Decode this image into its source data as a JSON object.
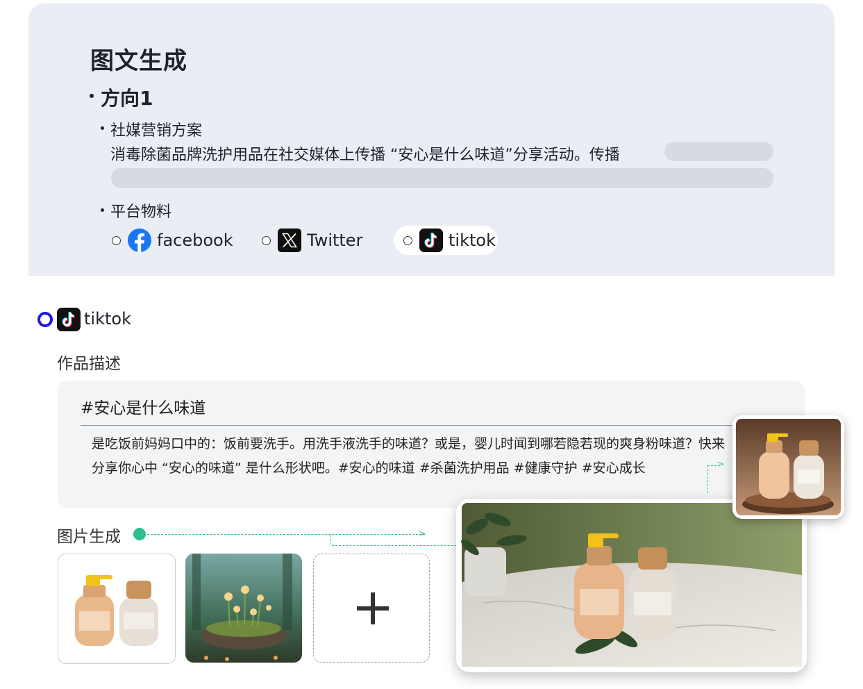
{
  "top_panel": {
    "title": "图文生成",
    "direction_title": "方向1",
    "social_title": "社媒营销方案",
    "social_description": "消毒除菌品牌洗护用品在社交媒体上传播 “安心是什么味道”分享活动。传播",
    "platform_title": "平台物料",
    "platforms": [
      {
        "label": "facebook",
        "icon": "facebook-icon",
        "selected": false
      },
      {
        "label": "Twitter",
        "icon": "x-twitter-icon",
        "selected": false
      },
      {
        "label": "tiktok",
        "icon": "tiktok-icon",
        "selected": false
      }
    ]
  },
  "selected_platform": {
    "label": "tiktok",
    "icon": "tiktok-icon",
    "accent": "#1f16e6"
  },
  "description": {
    "section_title": "作品描述",
    "hashtag": "#安心是什么味道",
    "body": "是吃饭前妈妈口中的：饭前要洗手。用洗手液洗手的味道？或是，婴儿时闻到哪若隐若现的爽身粉味道？快来分享你心中 “安心的味道” 是什么形状吧。#安心的味道 #杀菌洗护用品 #健康守护 #安心成长"
  },
  "image_generation": {
    "section_title": "图片生成",
    "accent": "#2fbf8f",
    "thumbnails": [
      "bottles-image",
      "flowers-on-rock-image",
      "add-image-button"
    ]
  }
}
